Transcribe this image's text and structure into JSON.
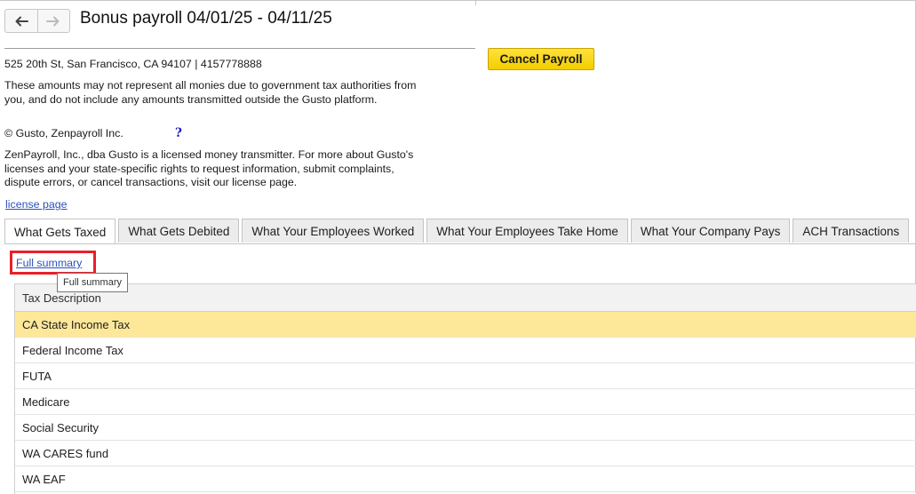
{
  "header": {
    "title": "Bonus payroll 04/01/25 - 04/11/25",
    "back_icon": "arrow-left-icon",
    "forward_icon": "arrow-right-icon"
  },
  "actions": {
    "cancel_label": "Cancel Payroll"
  },
  "info": {
    "address": "525 20th St, San Francisco, CA 94107 | 4157778888",
    "disclaimer": "These amounts may not represent all monies due to government tax authorities from you, and do not include any amounts transmitted outside the Gusto platform.",
    "copyright": "© Gusto, Zenpayroll Inc.",
    "help_mark": "?",
    "licensed": "ZenPayroll, Inc., dba Gusto is a licensed money transmitter. For more about Gusto's licenses and your state-specific rights to request information, submit complaints, dispute errors, or cancel transactions, visit our license page.",
    "license_link": "license page"
  },
  "tabs": [
    {
      "label": "What Gets Taxed",
      "active": true
    },
    {
      "label": "What Gets Debited",
      "active": false
    },
    {
      "label": "What Your Employees Worked",
      "active": false
    },
    {
      "label": "What Your Employees Take Home",
      "active": false
    },
    {
      "label": "What Your Company Pays",
      "active": false
    },
    {
      "label": "ACH Transactions",
      "active": false
    }
  ],
  "summary": {
    "link_label": "Full summary",
    "tooltip": "Full summary"
  },
  "table": {
    "header": "Tax Description",
    "rows": [
      "CA State Income Tax",
      "Federal Income Tax",
      "FUTA",
      "Medicare",
      "Social Security",
      "WA CARES fund",
      "WA EAF"
    ],
    "selected_index": 0
  },
  "colors": {
    "accent_button": "#f9d71c",
    "selected_row": "#fde89a",
    "highlight_box": "#e8202a",
    "link": "#2a52be"
  }
}
